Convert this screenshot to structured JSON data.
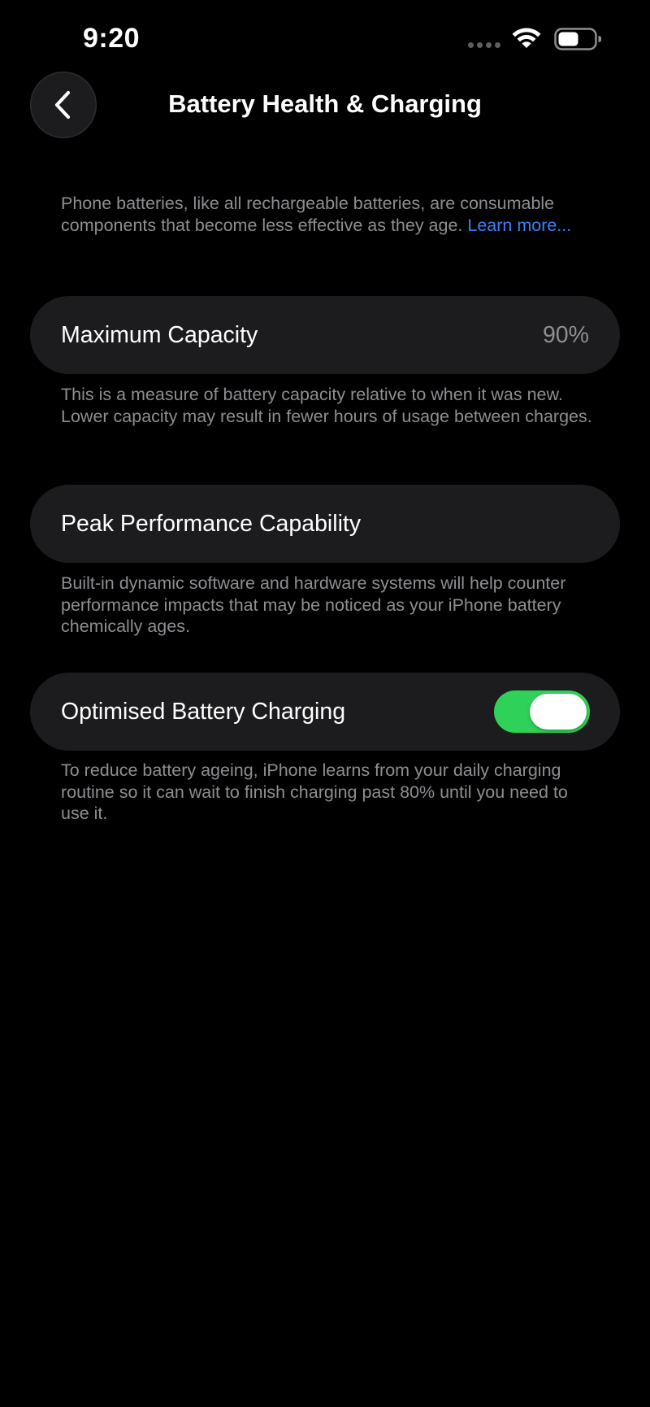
{
  "status_bar": {
    "time": "9:20",
    "icons": [
      "signal-dots-icon",
      "wifi-icon",
      "battery-icon"
    ]
  },
  "nav": {
    "back_icon": "chevron-left-icon",
    "title": "Battery Health & Charging"
  },
  "intro": {
    "text": "Phone batteries, like all rechargeable batteries, are consumable components that become less effective as they age. ",
    "link": "Learn more..."
  },
  "maximum_capacity": {
    "label": "Maximum Capacity",
    "value": "90%",
    "description": "This is a measure of battery capacity relative to when it was new. Lower capacity may result in fewer hours of usage between charges."
  },
  "peak_performance": {
    "label": "Peak Performance Capability",
    "description": "Built-in dynamic software and hardware systems will help counter performance impacts that may be noticed as your iPhone battery chemically ages."
  },
  "optimised_charging": {
    "label": "Optimised Battery Charging",
    "enabled": true,
    "description": "To reduce battery ageing, iPhone learns from your daily charging routine so it can wait to finish charging past 80% until you need to use it."
  },
  "colors": {
    "background": "#000000",
    "cell": "#1c1c1e",
    "secondary_text": "#8e8e93",
    "link": "#3b82f6",
    "toggle_on": "#30d158"
  }
}
